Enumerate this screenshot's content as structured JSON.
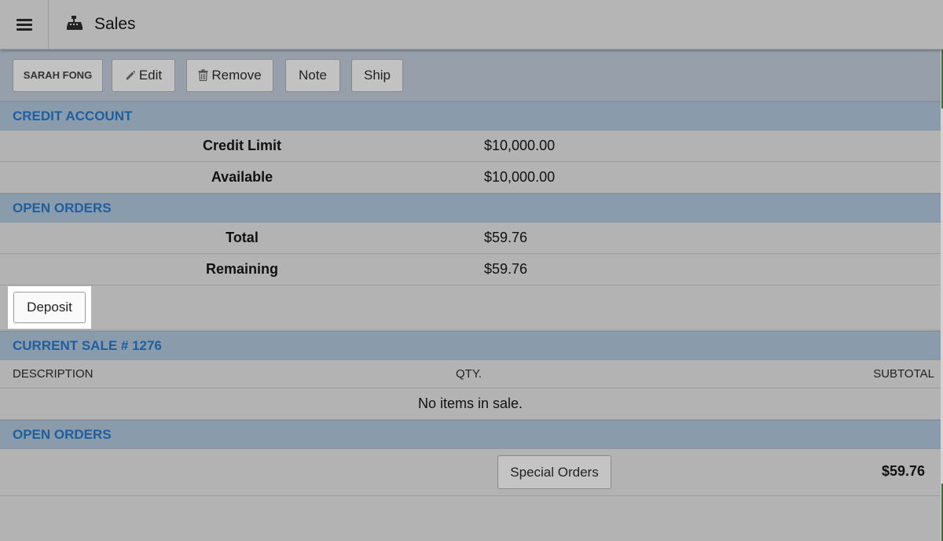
{
  "header": {
    "title": "Sales",
    "menu_icon": "hamburger-icon",
    "app_icon": "cash-register-icon"
  },
  "toolbar": {
    "customer_label": "SARAH FONG",
    "edit_label": "Edit",
    "remove_label": "Remove",
    "note_label": "Note",
    "ship_label": "Ship"
  },
  "credit_account": {
    "heading": "CREDIT ACCOUNT",
    "rows": [
      {
        "label": "Credit Limit",
        "value": "$10,000.00"
      },
      {
        "label": "Available",
        "value": "$10,000.00"
      }
    ]
  },
  "open_orders_summary": {
    "heading": "OPEN ORDERS",
    "rows": [
      {
        "label": "Total",
        "value": "$59.76"
      },
      {
        "label": "Remaining",
        "value": "$59.76"
      }
    ],
    "deposit_label": "Deposit"
  },
  "current_sale": {
    "heading": "CURRENT SALE # 1276",
    "columns": [
      "DESCRIPTION",
      "QTY.",
      "SUBTOTAL"
    ],
    "empty_message": "No items in sale."
  },
  "open_orders": {
    "heading": "OPEN ORDERS",
    "special_orders_label": "Special Orders",
    "total": "$59.76"
  },
  "colors": {
    "section_header_bg": "#8a9bac",
    "section_header_text": "#1f5f9e",
    "page_bg": "#b3b3b3"
  }
}
